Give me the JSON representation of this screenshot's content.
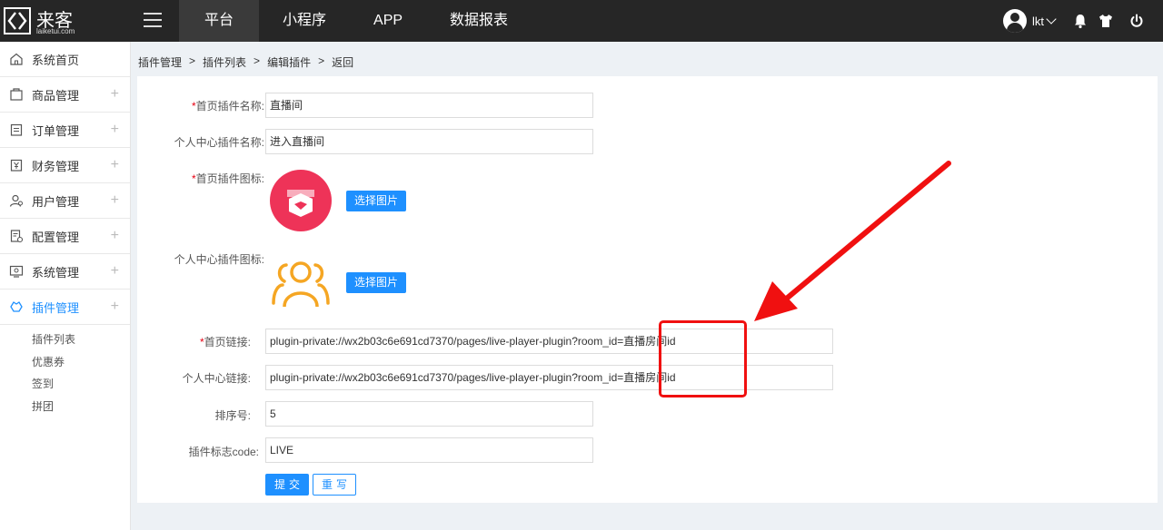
{
  "logo": {
    "name": "来客",
    "domain": "laiketui.com"
  },
  "nav": [
    "平台",
    "小程序",
    "APP",
    "数据报表"
  ],
  "user": {
    "name": "lkt"
  },
  "sidebar": {
    "items": [
      "系统首页",
      "商品管理",
      "订单管理",
      "财务管理",
      "用户管理",
      "配置管理",
      "系统管理",
      "插件管理"
    ],
    "plus": "+",
    "sub_items": [
      "插件列表",
      "优惠券",
      "签到",
      "拼团"
    ]
  },
  "breadcrumb": [
    "插件管理",
    "插件列表",
    "编辑插件",
    "返回"
  ],
  "breadcrumb_sep": ">",
  "form": {
    "required_mark": "*",
    "home_name_label": "首页插件名称:",
    "home_name_value": "直播间",
    "center_name_label": "个人中心插件名称:",
    "center_name_value": "进入直播间",
    "home_icon_label": "首页插件图标:",
    "center_icon_label": "个人中心插件图标:",
    "pick_image": "选择图片",
    "home_link_label": "首页链接:",
    "home_link_value": "plugin-private://wx2b03c6e691cd7370/pages/live-player-plugin?room_id=直播房间id",
    "center_link_label": "个人中心链接:",
    "center_link_value": "plugin-private://wx2b03c6e691cd7370/pages/live-player-plugin?room_id=直播房间id",
    "sort_label": "排序号:",
    "sort_value": "5",
    "code_label": "插件标志code:",
    "code_value": "LIVE",
    "submit": "提交",
    "reset": "重写"
  },
  "colors": {
    "accent": "#1e90ff",
    "topbar": "#262626",
    "required": "#e60012",
    "annotation": "#f01010",
    "home_icon": "#ee3358",
    "center_icon": "#f5a623"
  },
  "icons": {
    "home_plugin": "gift-box-icon",
    "center_plugin": "users-icon"
  }
}
